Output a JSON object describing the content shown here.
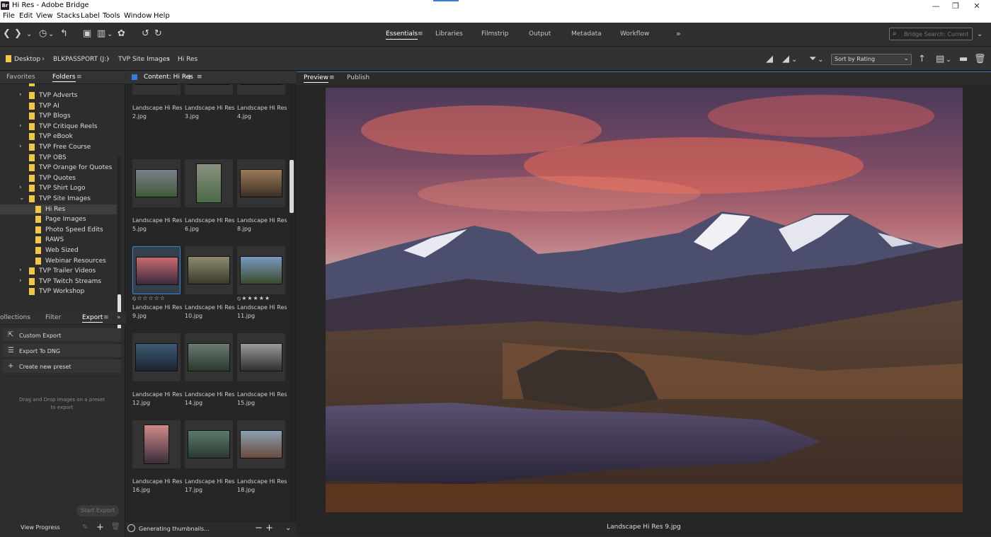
{
  "window": {
    "title": "Hi Res - Adobe Bridge",
    "app_badge": "Br"
  },
  "menu": [
    "File",
    "Edit",
    "View",
    "Stacks",
    "Label",
    "Tools",
    "Window",
    "Help"
  ],
  "workspaces": [
    {
      "label": "Essentials",
      "active": true
    },
    {
      "label": "Libraries"
    },
    {
      "label": "Filmstrip"
    },
    {
      "label": "Output"
    },
    {
      "label": "Metadata"
    },
    {
      "label": "Workflow"
    }
  ],
  "search": {
    "placeholder": "Bridge Search: Current"
  },
  "breadcrumb": [
    "Desktop",
    "BLKPASSPORT (J:)",
    "TVP Site Images",
    "Hi Res"
  ],
  "sort": {
    "value": "Sort by Rating"
  },
  "left_tabs": {
    "favorites": "Favorites",
    "folders": "Folders"
  },
  "folder_tree": [
    {
      "label": "TVP Adverts",
      "expandable": true,
      "level": 1
    },
    {
      "label": "TVP AI",
      "expandable": false,
      "level": 1
    },
    {
      "label": "TVP Blogs",
      "expandable": false,
      "level": 1
    },
    {
      "label": "TVP Critique Reels",
      "expandable": true,
      "level": 1
    },
    {
      "label": "TVP eBook",
      "expandable": false,
      "level": 1
    },
    {
      "label": "TVP Free Course",
      "expandable": true,
      "level": 1
    },
    {
      "label": "TVP OBS",
      "expandable": false,
      "level": 1
    },
    {
      "label": "TVP Orange for Quotes",
      "expandable": false,
      "level": 1
    },
    {
      "label": "TVP Quotes",
      "expandable": false,
      "level": 1
    },
    {
      "label": "TVP Shirt Logo",
      "expandable": true,
      "level": 1
    },
    {
      "label": "TVP Site Images",
      "expandable": true,
      "expanded": true,
      "level": 1
    },
    {
      "label": "Hi Res",
      "level": 2,
      "selected": true
    },
    {
      "label": "Page Images",
      "level": 2
    },
    {
      "label": "Photo Speed Edits",
      "level": 2
    },
    {
      "label": "RAWS",
      "level": 2
    },
    {
      "label": "Web Sized",
      "level": 2
    },
    {
      "label": "Webinar Resources",
      "level": 2
    },
    {
      "label": "TVP Trailer Videos",
      "expandable": true,
      "level": 1
    },
    {
      "label": "TVP Twitch Streams",
      "expandable": true,
      "level": 1
    },
    {
      "label": "TVP Workshop",
      "expandable": false,
      "level": 1
    }
  ],
  "bottom_tabs": {
    "collections": "ollections",
    "filter": "Filter",
    "export": "Export"
  },
  "export_items": [
    {
      "label": "Custom Export",
      "icon": "export-icon"
    },
    {
      "label": "Export To DNG",
      "icon": "list-icon"
    },
    {
      "label": "Create new preset",
      "icon": "plus-icon"
    }
  ],
  "dropzone_text": "Drag and Drop images on a preset to export",
  "start_export": "Start Export",
  "view_progress": "View Progress",
  "content_tab": "Content: Hi Res",
  "thumbnails": [
    {
      "name": "Landscape Hi Res\n2.jpg",
      "l1": "Landscape Hi Res",
      "l2": "2.jpg"
    },
    {
      "name": "Landscape Hi Res 3.jpg",
      "l1": "Landscape Hi Res",
      "l2": "3.jpg"
    },
    {
      "name": "Landscape Hi Res 4.jpg",
      "l1": "Landscape Hi Res",
      "l2": "4.jpg"
    },
    {
      "l1": "Landscape Hi Res",
      "l2": "5.jpg"
    },
    {
      "l1": "Landscape Hi Res",
      "l2": "6.jpg"
    },
    {
      "l1": "Landscape Hi Res",
      "l2": "8.jpg"
    },
    {
      "l1": "Landscape Hi Res",
      "l2": "9.jpg",
      "stars": "⦸☆☆☆☆☆",
      "selected": true
    },
    {
      "l1": "Landscape Hi Res",
      "l2": "10.jpg"
    },
    {
      "l1": "Landscape Hi Res",
      "l2": "11.jpg",
      "stars": "⦸★★★★★"
    },
    {
      "l1": "Landscape Hi Res",
      "l2": "12.jpg"
    },
    {
      "l1": "Landscape Hi Res",
      "l2": "14.jpg"
    },
    {
      "l1": "Landscape Hi Res",
      "l2": "15.jpg"
    },
    {
      "l1": "Landscape Hi Res",
      "l2": "16.jpg"
    },
    {
      "l1": "Landscape Hi Res",
      "l2": "17.jpg"
    },
    {
      "l1": "Landscape Hi Res",
      "l2": "18.jpg"
    }
  ],
  "status": {
    "generating": "Generating thumbnails..."
  },
  "preview_tabs": {
    "preview": "Preview",
    "publish": "Publish"
  },
  "preview_caption": "Landscape Hi Res 9.jpg",
  "colors": {
    "accent": "#3a80d0",
    "folder": "#f0c846"
  }
}
